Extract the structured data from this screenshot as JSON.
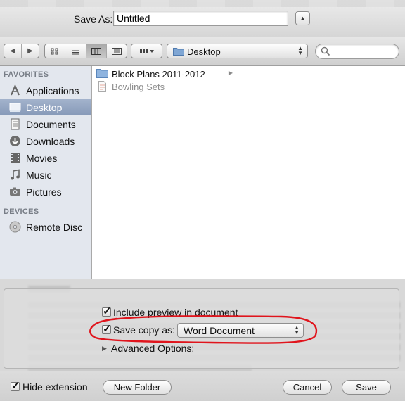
{
  "save_as": {
    "label": "Save As:",
    "filename": "Untitled"
  },
  "toolbar": {
    "location": "Desktop",
    "search_placeholder": ""
  },
  "sidebar": {
    "favorites_heading": "FAVORITES",
    "favorites": [
      {
        "label": "Applications",
        "icon": "applications-icon"
      },
      {
        "label": "Desktop",
        "icon": "desktop-icon",
        "selected": true
      },
      {
        "label": "Documents",
        "icon": "documents-icon"
      },
      {
        "label": "Downloads",
        "icon": "downloads-icon"
      },
      {
        "label": "Movies",
        "icon": "movies-icon"
      },
      {
        "label": "Music",
        "icon": "music-icon"
      },
      {
        "label": "Pictures",
        "icon": "pictures-icon"
      }
    ],
    "devices_heading": "DEVICES",
    "devices": [
      {
        "label": "Remote Disc",
        "icon": "remote-disc-icon"
      }
    ]
  },
  "files": [
    {
      "name": "Block Plans 2011-2012",
      "type": "folder",
      "icon": "folder-icon"
    },
    {
      "name": "Bowling Sets",
      "type": "document",
      "icon": "document-icon",
      "dimmed": true
    }
  ],
  "options": {
    "include_preview_label": "Include preview in document",
    "include_preview_checked": true,
    "save_copy_label": "Save copy as:",
    "save_copy_checked": true,
    "save_copy_format": "Word Document",
    "advanced_label": "Advanced Options:",
    "annotation_color": "#e0141c"
  },
  "bottom": {
    "hide_extension_label": "Hide extension",
    "hide_extension_checked": true,
    "new_folder_label": "New Folder",
    "cancel_label": "Cancel",
    "save_label": "Save"
  },
  "colors": {
    "sidebar_bg": "#e3e7ee",
    "selection": "#8a9dbb",
    "section_heading": "#777d86"
  }
}
